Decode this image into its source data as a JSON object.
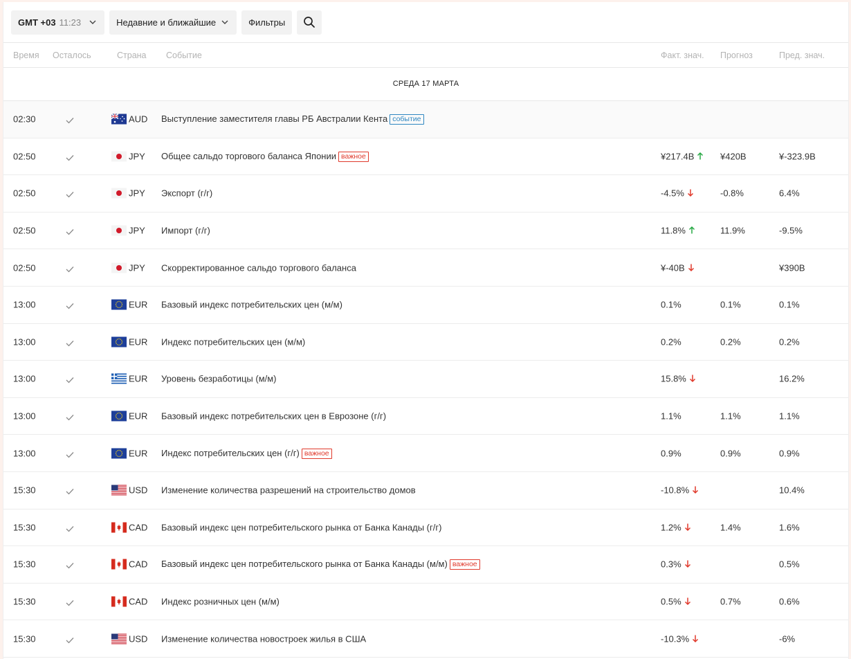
{
  "toolbar": {
    "timezone_label": "GMT +03",
    "timezone_time": "11:23",
    "sort_label": "Недавние и ближайшие",
    "filters_label": "Фильтры"
  },
  "columns": {
    "time": "Время",
    "remaining": "Осталось",
    "country": "Страна",
    "event": "Событие",
    "actual": "Факт. знач.",
    "forecast": "Прогноз",
    "previous": "Пред. знач."
  },
  "date_header": "СРЕДА 17 МАРТА",
  "colors": {
    "up": "#27a844",
    "down": "#e0392b",
    "tag_event": "#2e86c1",
    "tag_important": "#e0392b"
  },
  "rows": [
    {
      "time": "02:30",
      "flag": "au",
      "currency": "AUD",
      "event": "Выступление заместителя главы РБ Австралии Кента",
      "tag": "событие",
      "tag_kind": "event",
      "actual": "",
      "trend": "",
      "forecast": "",
      "previous": ""
    },
    {
      "time": "02:50",
      "flag": "jp",
      "currency": "JPY",
      "event": "Общее сальдо торгового баланса Японии",
      "tag": "важное",
      "tag_kind": "important",
      "actual": "¥217.4B",
      "trend": "up",
      "forecast": "¥420B",
      "previous": "¥-323.9B"
    },
    {
      "time": "02:50",
      "flag": "jp",
      "currency": "JPY",
      "event": "Экспорт (г/г)",
      "tag": "",
      "tag_kind": "",
      "actual": "-4.5%",
      "trend": "down",
      "forecast": "-0.8%",
      "previous": "6.4%"
    },
    {
      "time": "02:50",
      "flag": "jp",
      "currency": "JPY",
      "event": "Импорт (г/г)",
      "tag": "",
      "tag_kind": "",
      "actual": "11.8%",
      "trend": "up",
      "forecast": "11.9%",
      "previous": "-9.5%"
    },
    {
      "time": "02:50",
      "flag": "jp",
      "currency": "JPY",
      "event": "Скорректированное сальдо торгового баланса",
      "tag": "",
      "tag_kind": "",
      "actual": "¥-40B",
      "trend": "down",
      "forecast": "",
      "previous": "¥390B"
    },
    {
      "time": "13:00",
      "flag": "eu",
      "currency": "EUR",
      "event": "Базовый индекс потребительских цен (м/м)",
      "tag": "",
      "tag_kind": "",
      "actual": "0.1%",
      "trend": "",
      "forecast": "0.1%",
      "previous": "0.1%"
    },
    {
      "time": "13:00",
      "flag": "eu",
      "currency": "EUR",
      "event": "Индекс потребительских цен (м/м)",
      "tag": "",
      "tag_kind": "",
      "actual": "0.2%",
      "trend": "",
      "forecast": "0.2%",
      "previous": "0.2%"
    },
    {
      "time": "13:00",
      "flag": "gr",
      "currency": "EUR",
      "event": "Уровень безработицы (м/м)",
      "tag": "",
      "tag_kind": "",
      "actual": "15.8%",
      "trend": "down",
      "forecast": "",
      "previous": "16.2%"
    },
    {
      "time": "13:00",
      "flag": "eu",
      "currency": "EUR",
      "event": "Базовый индекс потребительских цен в Еврозоне (г/г)",
      "tag": "",
      "tag_kind": "",
      "actual": "1.1%",
      "trend": "",
      "forecast": "1.1%",
      "previous": "1.1%"
    },
    {
      "time": "13:00",
      "flag": "eu",
      "currency": "EUR",
      "event": "Индекс потребительских цен (г/г)",
      "tag": "важное",
      "tag_kind": "important",
      "actual": "0.9%",
      "trend": "",
      "forecast": "0.9%",
      "previous": "0.9%"
    },
    {
      "time": "15:30",
      "flag": "us",
      "currency": "USD",
      "event": "Изменение количества разрешений на строительство домов",
      "tag": "",
      "tag_kind": "",
      "actual": "-10.8%",
      "trend": "down",
      "forecast": "",
      "previous": "10.4%"
    },
    {
      "time": "15:30",
      "flag": "ca",
      "currency": "CAD",
      "event": "Базовый индекс цен потребительского рынка от Банка Канады (г/г)",
      "tag": "",
      "tag_kind": "",
      "actual": "1.2%",
      "trend": "down",
      "forecast": "1.4%",
      "previous": "1.6%"
    },
    {
      "time": "15:30",
      "flag": "ca",
      "currency": "CAD",
      "event": "Базовый индекс цен потребительского рынка от Банка Канады (м/м)",
      "tag": "важное",
      "tag_kind": "important",
      "actual": "0.3%",
      "trend": "down",
      "forecast": "",
      "previous": "0.5%"
    },
    {
      "time": "15:30",
      "flag": "ca",
      "currency": "CAD",
      "event": "Индекс розничных цен (м/м)",
      "tag": "",
      "tag_kind": "",
      "actual": "0.5%",
      "trend": "down",
      "forecast": "0.7%",
      "previous": "0.6%"
    },
    {
      "time": "15:30",
      "flag": "us",
      "currency": "USD",
      "event": "Изменение количества новостроек жилья в США",
      "tag": "",
      "tag_kind": "",
      "actual": "-10.3%",
      "trend": "down",
      "forecast": "",
      "previous": "-6%"
    }
  ]
}
